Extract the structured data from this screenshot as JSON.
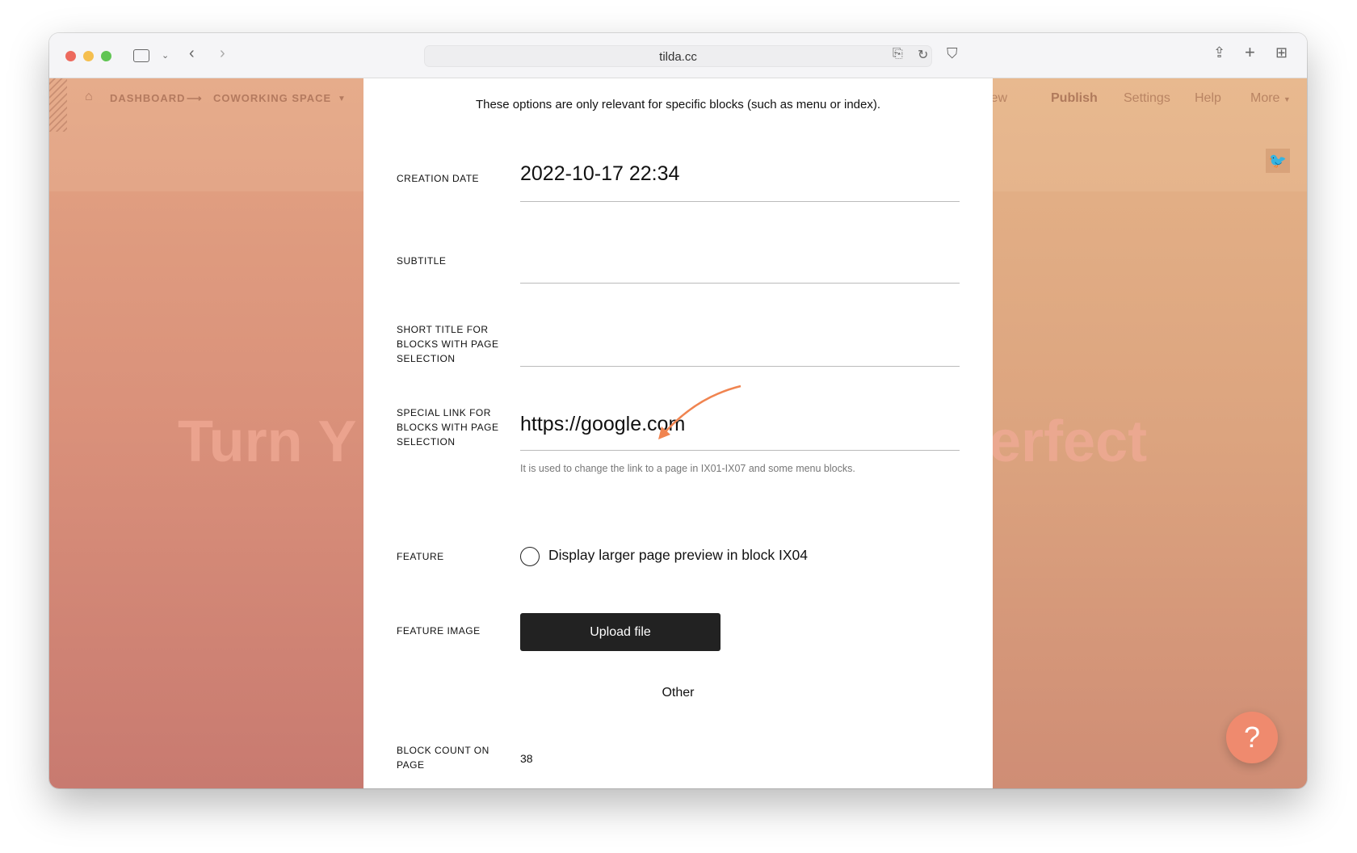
{
  "browser": {
    "url": "tilda.cc"
  },
  "site_nav": {
    "breadcrumb": [
      "DASHBOARD",
      "COWORKING SPACE"
    ],
    "arrow": "⟶",
    "items": [
      "eview",
      "Publish",
      "Settings",
      "Help",
      "More"
    ]
  },
  "background": {
    "headline_left": "Turn Y",
    "headline_right": "erfect"
  },
  "modal": {
    "note": "These options are only relevant for specific blocks (such as menu or index).",
    "creation_date": {
      "label": "CREATION DATE",
      "value": "2022-10-17 22:34"
    },
    "subtitle": {
      "label": "SUBTITLE",
      "value": ""
    },
    "short_title": {
      "label": "SHORT TITLE FOR BLOCKS WITH PAGE SELECTION",
      "value": ""
    },
    "special_link": {
      "label": "SPECIAL LINK FOR BLOCKS WITH PAGE SELECTION",
      "value": "https://google.com",
      "hint": "It is used to change the link to a page in IX01-IX07 and some menu blocks."
    },
    "feature": {
      "label": "FEATURE",
      "option": "Display larger page preview in block IX04",
      "checked": false
    },
    "feature_image": {
      "label": "FEATURE IMAGE",
      "button": "Upload file"
    },
    "other_heading": "Other",
    "block_count": {
      "label": "BLOCK COUNT ON PAGE",
      "value": "38"
    }
  },
  "help_button": "?",
  "colors": {
    "accent": "#ef8a6e",
    "button": "#222222",
    "arrow": "#f08450"
  }
}
